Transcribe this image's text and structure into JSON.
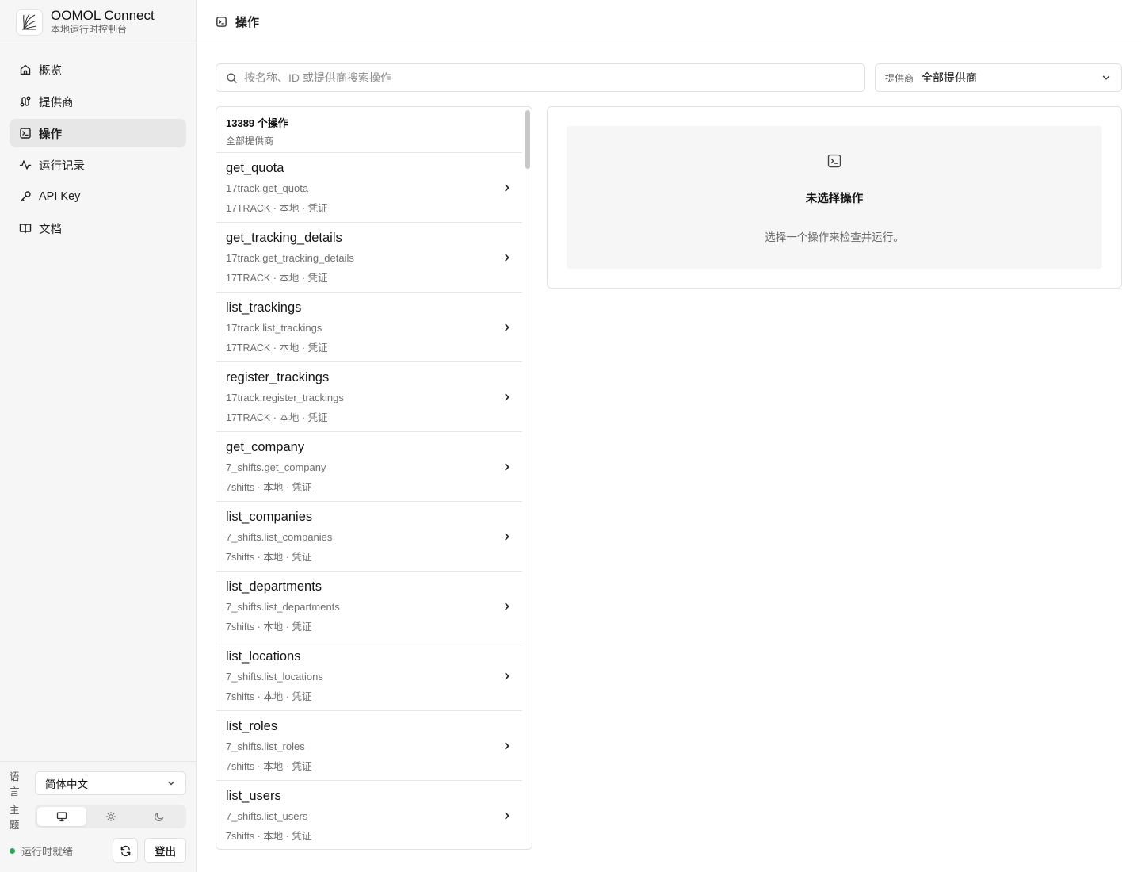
{
  "brand": {
    "name": "OOMOL Connect",
    "subtitle": "本地运行时控制台"
  },
  "nav": [
    {
      "label": "概览",
      "icon": "home-icon"
    },
    {
      "label": "提供商",
      "icon": "route-icon"
    },
    {
      "label": "操作",
      "icon": "terminal-icon",
      "active": true
    },
    {
      "label": "运行记录",
      "icon": "activity-icon"
    },
    {
      "label": "API Key",
      "icon": "key-icon"
    },
    {
      "label": "文档",
      "icon": "book-icon"
    }
  ],
  "bottom": {
    "language_label": "语言",
    "language_value": "简体中文",
    "theme_label": "主题",
    "theme_selected": "system",
    "status_text": "运行时就绪",
    "status_color": "#2fa457",
    "logout_label": "登出"
  },
  "header": {
    "title": "操作"
  },
  "search": {
    "placeholder": "按名称、ID 或提供商搜索操作",
    "value": ""
  },
  "provider_filter": {
    "label": "提供商",
    "value": "全部提供商"
  },
  "list": {
    "count_text": "13389 个操作",
    "filter_text": "全部提供商",
    "items": [
      {
        "name": "get_quota",
        "id": "17track.get_quota",
        "meta": "17TRACK · 本地 · 凭证"
      },
      {
        "name": "get_tracking_details",
        "id": "17track.get_tracking_details",
        "meta": "17TRACK · 本地 · 凭证"
      },
      {
        "name": "list_trackings",
        "id": "17track.list_trackings",
        "meta": "17TRACK · 本地 · 凭证"
      },
      {
        "name": "register_trackings",
        "id": "17track.register_trackings",
        "meta": "17TRACK · 本地 · 凭证"
      },
      {
        "name": "get_company",
        "id": "7_shifts.get_company",
        "meta": "7shifts · 本地 · 凭证"
      },
      {
        "name": "list_companies",
        "id": "7_shifts.list_companies",
        "meta": "7shifts · 本地 · 凭证"
      },
      {
        "name": "list_departments",
        "id": "7_shifts.list_departments",
        "meta": "7shifts · 本地 · 凭证"
      },
      {
        "name": "list_locations",
        "id": "7_shifts.list_locations",
        "meta": "7shifts · 本地 · 凭证"
      },
      {
        "name": "list_roles",
        "id": "7_shifts.list_roles",
        "meta": "7shifts · 本地 · 凭证"
      },
      {
        "name": "list_users",
        "id": "7_shifts.list_users",
        "meta": "7shifts · 本地 · 凭证"
      }
    ]
  },
  "detail": {
    "empty_title": "未选择操作",
    "empty_desc": "选择一个操作来检查并运行。"
  }
}
